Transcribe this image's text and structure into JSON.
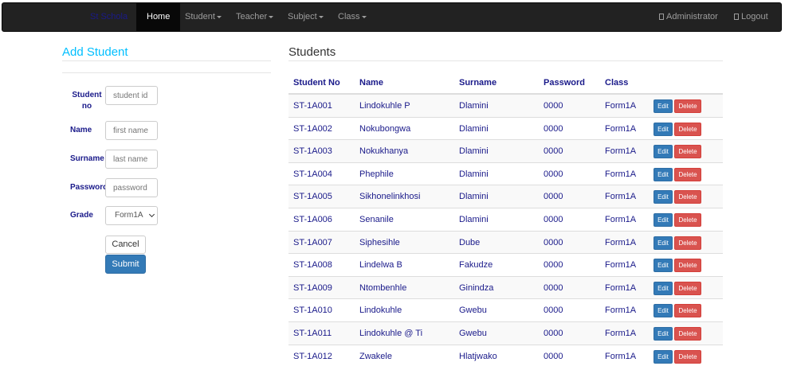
{
  "navbar": {
    "brand": "St Schola",
    "items": [
      {
        "label": "Home",
        "active": true
      },
      {
        "label": "Student",
        "dropdown": true
      },
      {
        "label": "Teacher",
        "dropdown": true
      },
      {
        "label": "Subject",
        "dropdown": true
      },
      {
        "label": "Class",
        "dropdown": true
      }
    ],
    "user": "Administrator",
    "logout": "Logout"
  },
  "form": {
    "title": "Add Student",
    "fields": [
      {
        "label": "Student no",
        "placeholder": "student id"
      },
      {
        "label": "Name",
        "placeholder": "first name"
      },
      {
        "label": "Surname",
        "placeholder": "last name"
      },
      {
        "label": "Password",
        "placeholder": "password"
      }
    ],
    "grade": {
      "label": "Grade",
      "selected": "Form1A"
    },
    "cancel_label": "Cancel",
    "submit_label": "Submit"
  },
  "list": {
    "title": "Students",
    "columns": [
      "Student No",
      "Name",
      "Surname",
      "Password",
      "Class"
    ],
    "edit_label": "Edit",
    "delete_label": "Delete",
    "rows": [
      [
        "ST-1A001",
        "Lindokuhle P",
        "Dlamini",
        "0000",
        "Form1A"
      ],
      [
        "ST-1A002",
        "Nokubongwa",
        "Dlamini",
        "0000",
        "Form1A"
      ],
      [
        "ST-1A003",
        "Nokukhanya",
        "Dlamini",
        "0000",
        "Form1A"
      ],
      [
        "ST-1A004",
        "Phephile",
        "Dlamini",
        "0000",
        "Form1A"
      ],
      [
        "ST-1A005",
        "Sikhonelinkhosi",
        "Dlamini",
        "0000",
        "Form1A"
      ],
      [
        "ST-1A006",
        "Senanile",
        "Dlamini",
        "0000",
        "Form1A"
      ],
      [
        "ST-1A007",
        "Siphesihle",
        "Dube",
        "0000",
        "Form1A"
      ],
      [
        "ST-1A008",
        "Lindelwa B",
        "Fakudze",
        "0000",
        "Form1A"
      ],
      [
        "ST-1A009",
        "Ntombenhle",
        "Ginindza",
        "0000",
        "Form1A"
      ],
      [
        "ST-1A010",
        "Lindokuhle",
        "Gwebu",
        "0000",
        "Form1A"
      ],
      [
        "ST-1A011",
        "Lindokuhle @ Ti",
        "Gwebu",
        "0000",
        "Form1A"
      ],
      [
        "ST-1A012",
        "Zwakele",
        "Hlatjwako",
        "0000",
        "Form1A"
      ]
    ]
  },
  "colors": {
    "navbar_bg": "#222222",
    "accent_title": "#00bfff",
    "text_link": "#1a1a8a",
    "primary": "#337ab7",
    "danger": "#d9534f"
  }
}
